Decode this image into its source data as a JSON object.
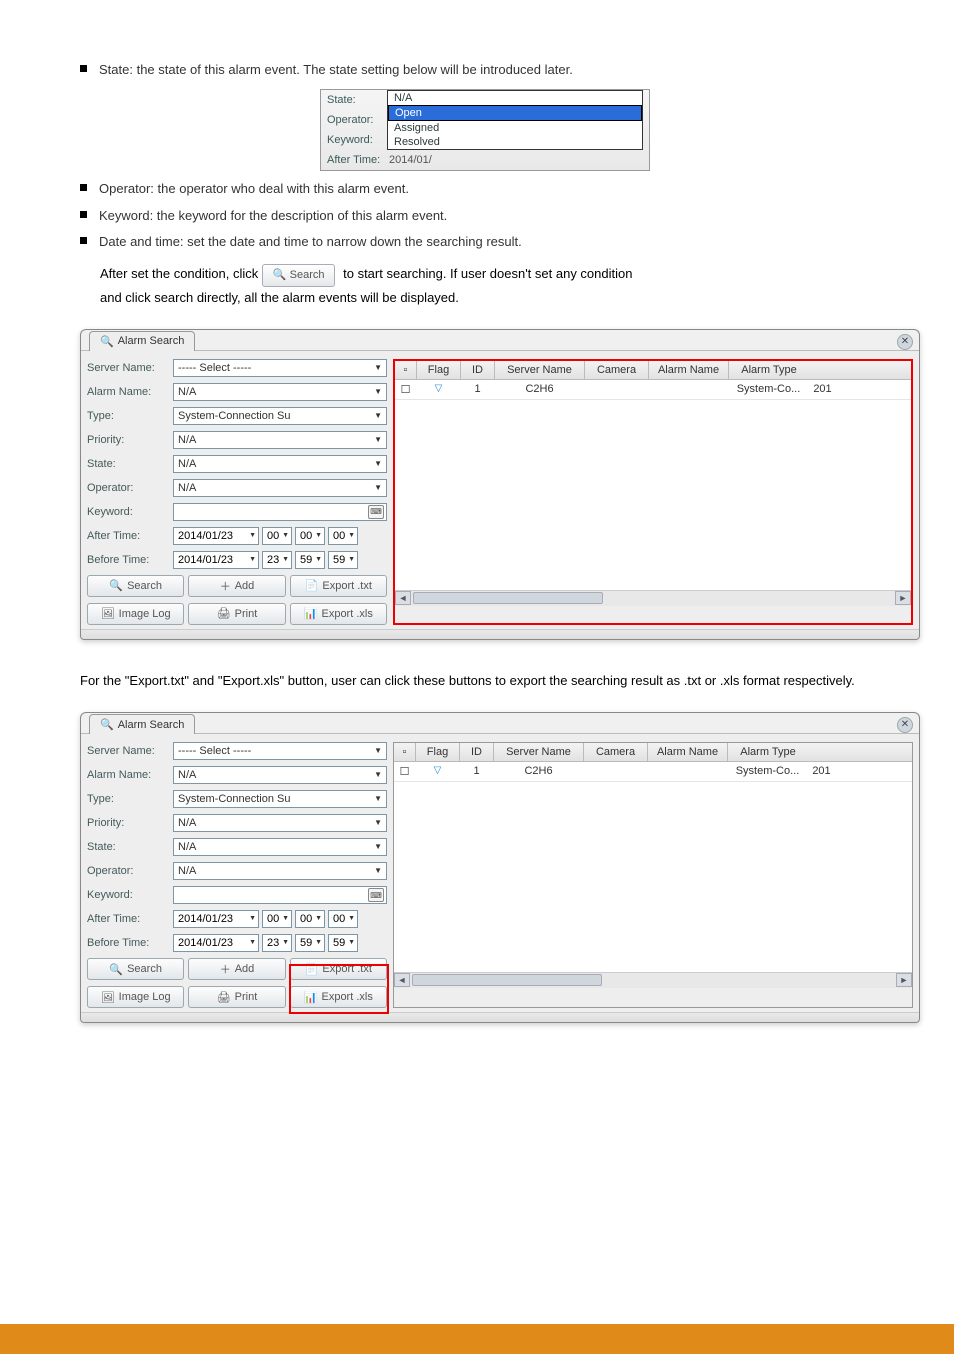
{
  "bullets": {
    "b1": "State: the state of this alarm event. The state setting below will be introduced later.",
    "b2": "Operator: the operator who deal with this alarm event.",
    "b3": "Keyword: the keyword for the description of this alarm event.",
    "b4_prefix": "Date and time: set the date and time to narrow down the searching result.",
    "b5_prefix": "After set the condition, click ",
    "b5_click": "to start searching. If user doesn't set any condition",
    "b5_rest": "and click search directly, all the alarm events will be displayed."
  },
  "small_panel": {
    "state_label": "State:",
    "state_value": "N/A",
    "operator_label": "Operator:",
    "operator_value": "N/A",
    "keyword_label": "Keyword:",
    "after_label": "After Time:",
    "options": {
      "na": "N/A",
      "open": "Open",
      "assigned": "Assigned",
      "resolved": "Resolved"
    },
    "date_partial": "2014/01/"
  },
  "window": {
    "title": "Alarm Search",
    "labels": {
      "server": "Server Name:",
      "alarm": "Alarm Name:",
      "type": "Type:",
      "priority": "Priority:",
      "state": "State:",
      "operator": "Operator:",
      "keyword": "Keyword:",
      "after": "After Time:",
      "before": "Before Time:"
    },
    "values": {
      "server": "-----   Select   -----",
      "alarm": "N/A",
      "type": "System-Connection Su",
      "priority": "N/A",
      "state": "N/A",
      "operator": "N/A",
      "after_date": "2014/01/23",
      "after_h": "00",
      "after_m": "00",
      "after_s": "00",
      "before_date": "2014/01/23",
      "before_h": "23",
      "before_m": "59",
      "before_s": "59"
    },
    "buttons": {
      "search": "Search",
      "add": "Add",
      "export_txt": "Export .txt",
      "image_log": "Image Log",
      "print": "Print",
      "export_xls": "Export .xls"
    },
    "table": {
      "headers": {
        "flag": "Flag",
        "id": "ID",
        "server": "Server Name",
        "camera": "Camera",
        "alarm_name": "Alarm Name",
        "alarm_type": "Alarm Type"
      },
      "row": {
        "flag_icon": "▽",
        "id": "1",
        "server": "C2H6",
        "camera": "",
        "alarm_name": "",
        "alarm_type": "System-Co...",
        "extra": "201"
      }
    }
  },
  "note_export": "For the \"Export.txt\" and \"Export.xls\" button, user can click these buttons to export the searching result as .txt or .xls format respectively."
}
